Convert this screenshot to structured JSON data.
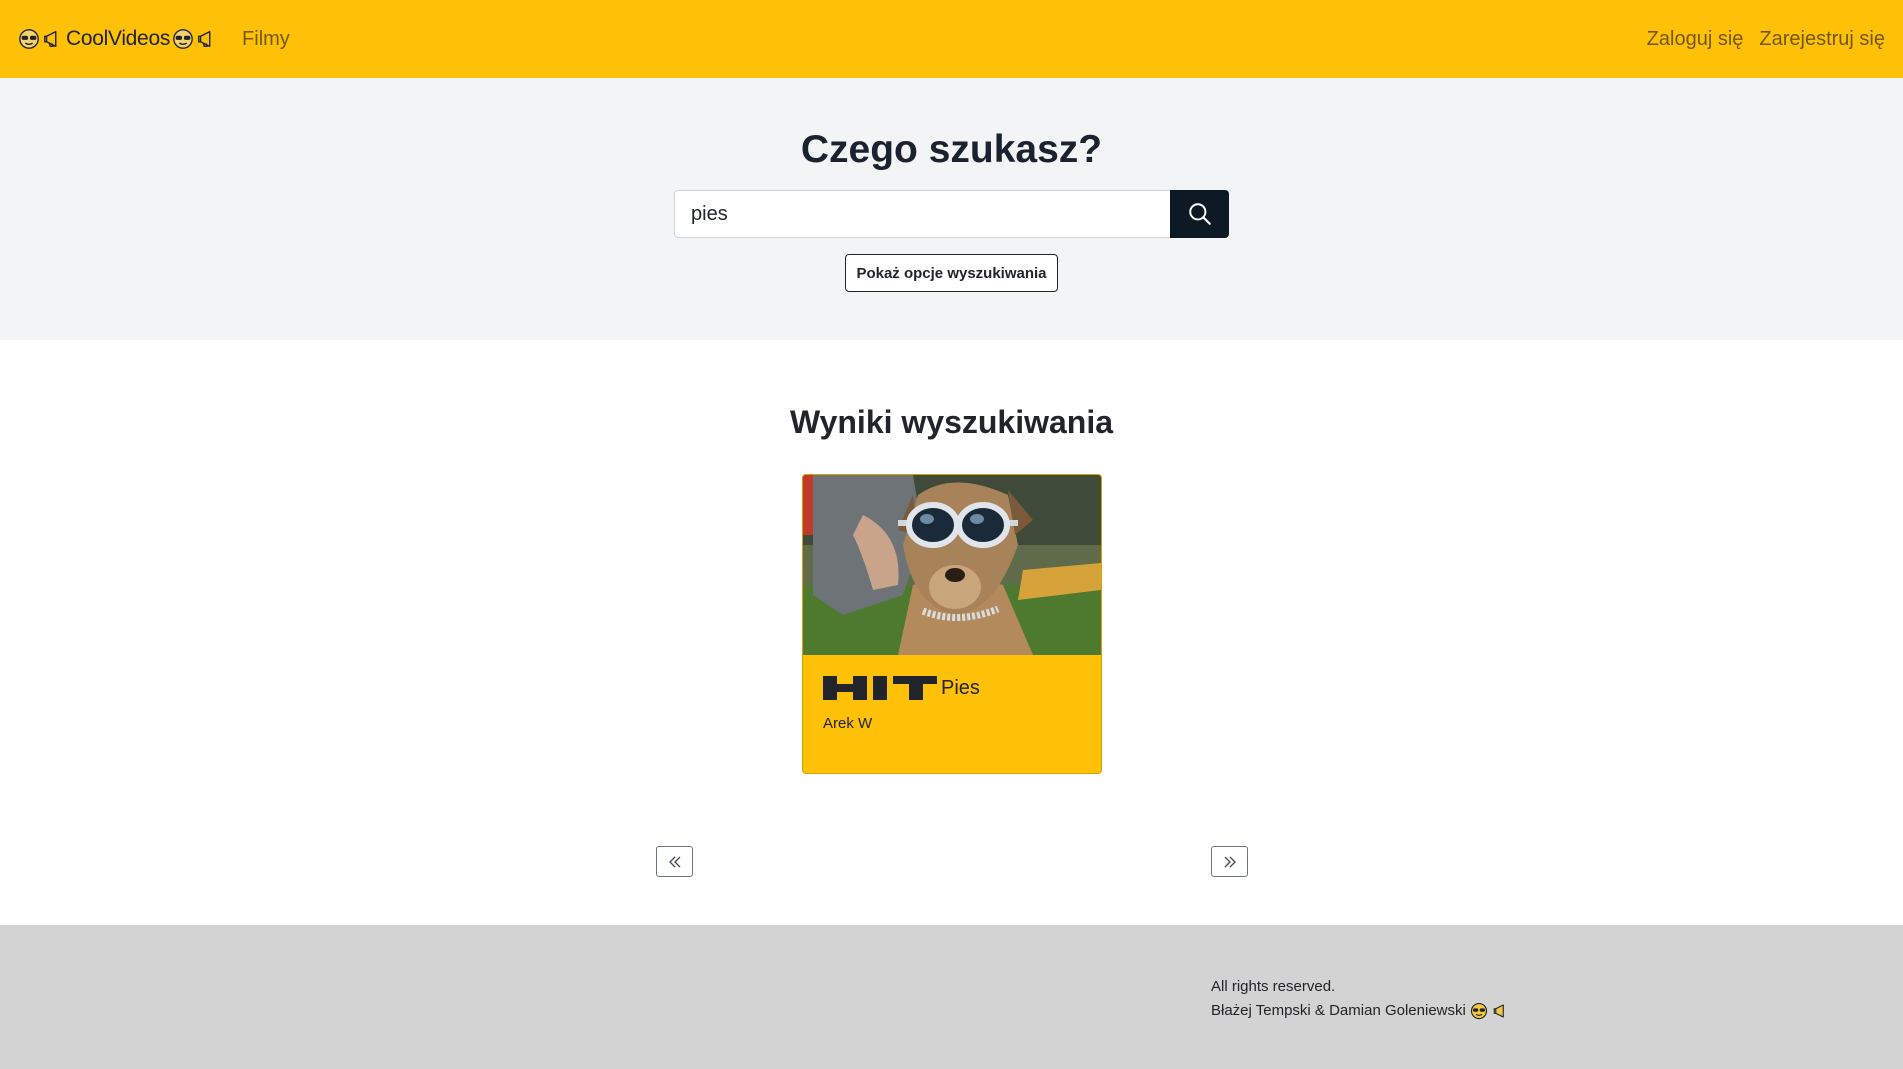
{
  "navbar": {
    "brand_text": "CoolVideos",
    "films_link": "Filmy",
    "login_link": "Zaloguj się",
    "register_link": "Zarejestruj się",
    "bg_color": "#ffc107"
  },
  "hero": {
    "title": "Czego szukasz?",
    "search_value": "pies",
    "search_icon": "search-icon",
    "options_button": "Pokaż opcje wyszukiwania"
  },
  "results": {
    "title": "Wyniki wyszukiwania",
    "items": [
      {
        "badge": "HIT",
        "title": "Pies",
        "author": "Arek W",
        "thumbnail": "dog-with-goggles"
      }
    ]
  },
  "pagination": {
    "prev_icon": "chevron-double-left-icon",
    "next_icon": "chevron-double-right-icon"
  },
  "footer": {
    "line1": "All rights reserved.",
    "line2": "Błażej Tempski & Damian Goleniewski"
  }
}
